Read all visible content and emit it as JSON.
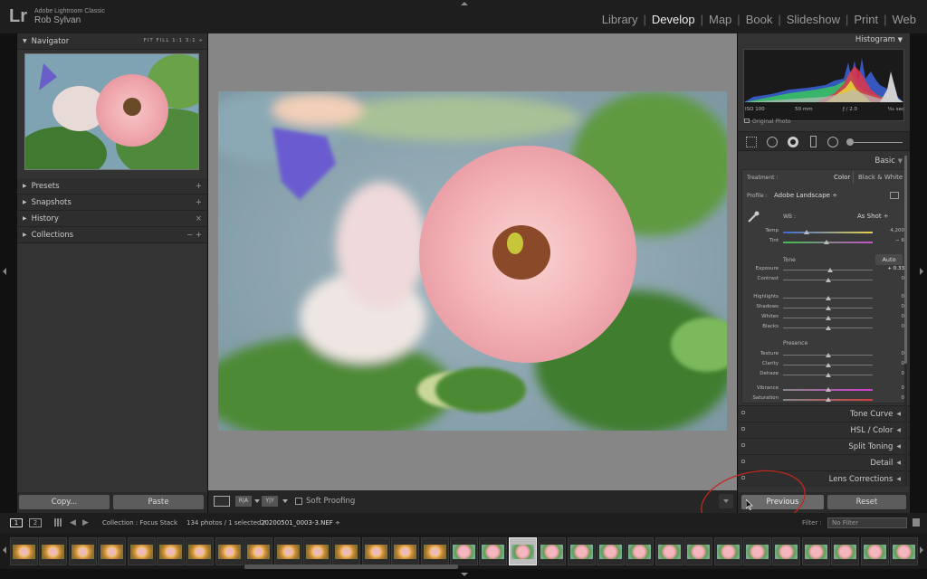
{
  "app": {
    "logo": "Lr",
    "name": "Adobe Lightroom Classic",
    "user": "Rob Sylvan"
  },
  "modules": [
    {
      "label": "Library",
      "active": false
    },
    {
      "label": "Develop",
      "active": true
    },
    {
      "label": "Map",
      "active": false
    },
    {
      "label": "Book",
      "active": false
    },
    {
      "label": "Slideshow",
      "active": false
    },
    {
      "label": "Print",
      "active": false
    },
    {
      "label": "Web",
      "active": false
    }
  ],
  "left": {
    "navigator": {
      "title": "Navigator",
      "zoom_options": "FIT  FILL  1:1  3:1 ÷"
    },
    "panels": [
      {
        "label": "Presets",
        "action": "+"
      },
      {
        "label": "Snapshots",
        "action": "+"
      },
      {
        "label": "History",
        "action": "×"
      },
      {
        "label": "Collections",
        "action": "−  +"
      }
    ],
    "copy_label": "Copy...",
    "paste_label": "Paste"
  },
  "toolbar": {
    "soft_proofing": "Soft Proofing",
    "view_a": "R|A",
    "view_b": "Y|Y"
  },
  "histogram": {
    "title": "Histogram",
    "iso": "ISO 100",
    "focal": "50 mm",
    "aperture": "ƒ / 2.0",
    "shutter": "¹⁄₆₀ sec",
    "original": "Original Photo"
  },
  "basic": {
    "title": "Basic",
    "treatment_label": "Treatment :",
    "treatment_color": "Color",
    "treatment_bw": "Black & White",
    "profile_label": "Profile :",
    "profile_value": "Adobe Landscape ÷",
    "wb_label": "WB :",
    "wb_value": "As Shot ÷",
    "tone_label": "Tone",
    "auto_label": "Auto",
    "presence_label": "Presence",
    "sliders": [
      {
        "label": "Temp",
        "value": "4,200",
        "pos": 0.26
      },
      {
        "label": "Tint",
        "value": "− 6",
        "pos": 0.48
      },
      {
        "label": "Exposure",
        "value": "+ 0.33",
        "pos": 0.53
      },
      {
        "label": "Contrast",
        "value": "0",
        "pos": 0.5
      },
      {
        "label": "Highlights",
        "value": "0",
        "pos": 0.5
      },
      {
        "label": "Shadows",
        "value": "0",
        "pos": 0.5
      },
      {
        "label": "Whites",
        "value": "0",
        "pos": 0.5
      },
      {
        "label": "Blacks",
        "value": "0",
        "pos": 0.5
      },
      {
        "label": "Texture",
        "value": "0",
        "pos": 0.5
      },
      {
        "label": "Clarity",
        "value": "0",
        "pos": 0.5
      },
      {
        "label": "Dehaze",
        "value": "0",
        "pos": 0.5
      },
      {
        "label": "Vibrance",
        "value": "0",
        "pos": 0.5
      },
      {
        "label": "Saturation",
        "value": "0",
        "pos": 0.5
      }
    ]
  },
  "sections": [
    {
      "label": "Tone Curve"
    },
    {
      "label": "HSL / Color"
    },
    {
      "label": "Split Toning"
    },
    {
      "label": "Detail"
    },
    {
      "label": "Lens Corrections"
    }
  ],
  "right_bottom": {
    "previous_label": "Previous",
    "reset_label": "Reset"
  },
  "filmbar": {
    "page1": "1",
    "page2": "2",
    "collection": "Collection : Focus Stack",
    "count": "134 photos / 1 selected /",
    "filename": "20200501_0003-3.NEF ÷",
    "filter_label": "Filter :",
    "filter_value": "No Filter"
  },
  "colors": {
    "annotation_circle": "#c0281e",
    "accent": "#e6e6e6"
  }
}
